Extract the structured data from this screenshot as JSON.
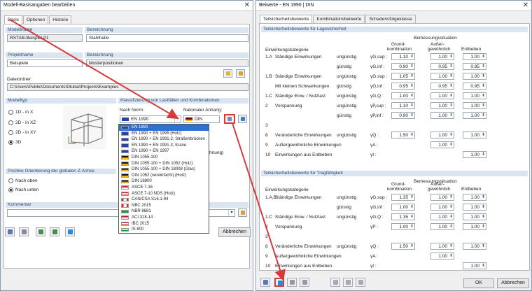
{
  "left": {
    "title": "Modell-Basisangaben bearbeiten",
    "tabs": [
      "Basis",
      "Optionen",
      "Historie"
    ],
    "modellname_label": "Modellname",
    "modellname": "RSTAB-Beispiel-01",
    "bezeichnung_label": "Bezeichnung",
    "bezeichnung": "Stahlhalle",
    "projektname_label": "Projektname",
    "projektname": "Beispiele",
    "proj_bezeichnung_label": "Bezeichnung",
    "proj_bezeichnung": "Musterpositionen",
    "datei_label": "Dateiordner:",
    "datei": "C:\\Users\\Public\\Documents\\Dlubal\\Projects\\Examples",
    "modelltyp_label": "Modelltyp",
    "modelltyp_options": [
      "1D - in X",
      "2D - in XZ",
      "2D - in XY",
      "3D"
    ],
    "klass_label": "Klassifizierung von Lastfällen und Kombinationen",
    "norm_label": "Nach Norm:",
    "norm_value": "EN 1990",
    "anhang_label": "Nationaler Anhang:",
    "anhang_value": "DIN",
    "dropdown": [
      "EN 1990",
      "EN 1990 + EN 1995 (Holz)",
      "EN 1990 + EN 1991-2; Straßenbrücken",
      "EN 1990 + EN 1991-3; Krane",
      "EN 1990 + EN 1997",
      "DIN 1055-100",
      "DIN 1055-100 + DIN 1052 (Holz)",
      "DIN 1055-100 + DIN 18008 (Glas)",
      "DIN 1052 (vereinfacht) (Holz)",
      "DIN 18800",
      "ASCE 7-16",
      "ASCE 7-10 NDS (Holz)",
      "CAN/CSA S16.1-94",
      "NBC 2015",
      "NBR 8681",
      "ACI 318-14",
      "IBC 2015",
      "IS 800"
    ],
    "berechnung_fragment": "Berechnung)",
    "z_achse_label": "Positive Orientierung der globalen Z-Achse",
    "z_options": [
      "Nach oben",
      "Nach unten"
    ],
    "kommentar_label": "Kommentar",
    "abbrechen": "Abbrechen"
  },
  "right": {
    "title": "Beiwerte - EN 1990 | DIN",
    "tabs": [
      "Teilsicherheitsbeiwerte",
      "Kombinationsbeiwerte",
      "Schadensfolgeklasse"
    ],
    "sec1_title": "Teilsicherheitsbeiwerte für Lagesicherheit",
    "sec2_title": "Teilsicherheitsbeiwerte für Tragfähigkeit",
    "einwirkungskategorie": "Einwirkungskategorie",
    "bemessung": "Bemessungssituation",
    "col_grund": [
      "Grund-",
      "kombination"
    ],
    "col_ausser": [
      "Außer-",
      "gewöhnlich"
    ],
    "col_erdbeben": "Erdbeben",
    "sec1_rows": [
      {
        "no": "1.A",
        "name": "Ständige Einwirkungen",
        "cond": "ungünstig",
        "sym": "γG,sup :",
        "g": "1.10",
        "a": "1.00",
        "e": "1.00"
      },
      {
        "no": "",
        "name": "",
        "cond": "günstig",
        "sym": "γG,inf :",
        "g": "0.90",
        "a": "0.95",
        "e": "0.95"
      },
      {
        "no": "1.B",
        "name": "Ständige Einwirkungen",
        "cond": "ungünstig",
        "sym": "γG,sup :",
        "g": "1.05",
        "a": "1.00",
        "e": "1.00"
      },
      {
        "no": "",
        "name": "Mit kleinen Schwankungen",
        "cond": "günstig",
        "sym": "γG,inf :",
        "g": "0.95",
        "a": "0.95",
        "e": "0.95"
      },
      {
        "no": "1.C",
        "name": "Ständige Einw. / Nutzlast",
        "cond": "ungünstig",
        "sym": "γG,Q :",
        "g": "1.00",
        "a": "1.00",
        "e": "1.00"
      },
      {
        "no": "2",
        "name": "Vorspannung",
        "cond": "ungünstig",
        "sym": "γP,sup :",
        "g": "1.10",
        "a": "1.00",
        "e": "1.00"
      },
      {
        "no": "",
        "name": "",
        "cond": "günstig",
        "sym": "γP,inf :",
        "g": "0.90",
        "a": "1.00",
        "e": "1.00"
      },
      {
        "no": "3",
        "name": "",
        "cond": "",
        "sym": "",
        "g": "",
        "a": "",
        "e": ""
      },
      {
        "no": "8",
        "name": "Veränderliche Einwirkungen",
        "cond": "ungünstig",
        "sym": "γQ :",
        "g": "1.50",
        "a": "1.00",
        "e": "1.00"
      },
      {
        "no": "9",
        "name": "Außergewöhnliche Einwirkungen",
        "cond": "",
        "sym": "γA :",
        "g": "",
        "a": "1.00",
        "e": ""
      },
      {
        "no": "10",
        "name": "Einwirkungen aus Erdbeben",
        "cond": "",
        "sym": "γI :",
        "g": "",
        "a": "",
        "e": "1.00"
      }
    ],
    "sec2_rows": [
      {
        "no": "1.A,B",
        "name": "Ständige Einwirkungen",
        "cond": "ungünstig",
        "sym": "γG,sup :",
        "g": "1.35",
        "a": "1.00",
        "e": "1.00"
      },
      {
        "no": "",
        "name": "",
        "cond": "günstig",
        "sym": "γG,inf :",
        "g": "1.00",
        "a": "1.00",
        "e": "1.00"
      },
      {
        "no": "1.C",
        "name": "Ständige Einw. / Nutzlast",
        "cond": "ungünstig",
        "sym": "γG,Q :",
        "g": "1.35",
        "a": "1.00",
        "e": "1.00"
      },
      {
        "no": "2",
        "name": "Vorspannung",
        "cond": "",
        "sym": "γP :",
        "g": "1.00",
        "a": "1.00",
        "e": "1.00"
      },
      {
        "no": "3",
        "name": "",
        "cond": "",
        "sym": "",
        "g": "",
        "a": "",
        "e": ""
      },
      {
        "no": "8",
        "name": "Veränderliche Einwirkungen",
        "cond": "ungünstig",
        "sym": "γQ :",
        "g": "1.50",
        "a": "1.00",
        "e": "1.00"
      },
      {
        "no": "9",
        "name": "Außergewöhnliche Einwirkungen",
        "cond": "",
        "sym": "γA :",
        "g": "",
        "a": "1.00",
        "e": ""
      },
      {
        "no": "10",
        "name": "Einwirkungen aus Erdbeben",
        "cond": "",
        "sym": "γI :",
        "g": "",
        "a": "",
        "e": "1.00"
      }
    ],
    "ok": "OK",
    "abbrechen": "Abbrechen"
  },
  "colors": {
    "accent": "#3070d0",
    "header": "#dbe5f1",
    "arrow": "#d63a3a"
  }
}
